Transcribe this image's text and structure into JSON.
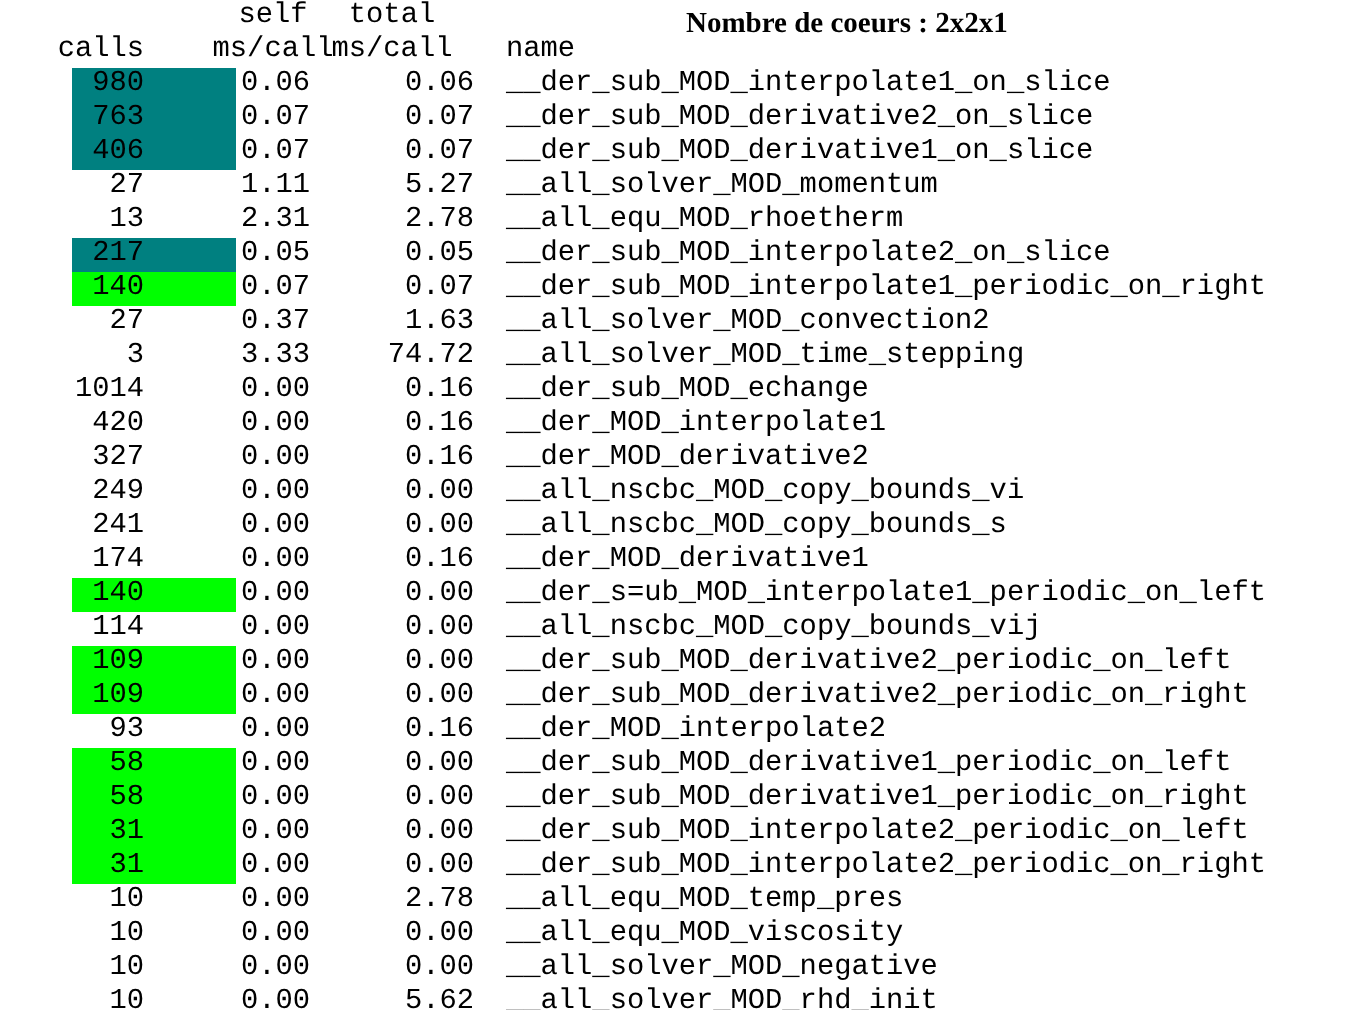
{
  "title": "Nombre de coeurs : 2x2x1",
  "columns": [
    {
      "lines": [
        "calls"
      ]
    },
    {
      "lines": [
        "self",
        "ms/call"
      ]
    },
    {
      "lines": [
        "total",
        "ms/call"
      ]
    },
    {
      "lines": [
        "name"
      ]
    }
  ],
  "rows": [
    {
      "calls": "980",
      "self": "0.06",
      "total": "0.06",
      "name": "__der_sub_MOD_interpolate1_on_slice",
      "color": "#008080"
    },
    {
      "calls": "763",
      "self": "0.07",
      "total": "0.07",
      "name": "__der_sub_MOD_derivative2_on_slice",
      "color": "#008080"
    },
    {
      "calls": "406",
      "self": "0.07",
      "total": "0.07",
      "name": "__der_sub_MOD_derivative1_on_slice",
      "color": "#008080"
    },
    {
      "calls": "27",
      "self": "1.11",
      "total": "5.27",
      "name": "__all_solver_MOD_momentum"
    },
    {
      "calls": "13",
      "self": "2.31",
      "total": "2.78",
      "name": "__all_equ_MOD_rhoetherm"
    },
    {
      "calls": "217",
      "self": "0.05",
      "total": "0.05",
      "name": "__der_sub_MOD_interpolate2_on_slice",
      "color": "#008080"
    },
    {
      "calls": "140",
      "self": "0.07",
      "total": "0.07",
      "name": "__der_sub_MOD_interpolate1_periodic_on_right",
      "color": "#00ff00"
    },
    {
      "calls": "27",
      "self": "0.37",
      "total": "1.63",
      "name": "__all_solver_MOD_convection2"
    },
    {
      "calls": "3",
      "self": "3.33",
      "total": "74.72",
      "name": "__all_solver_MOD_time_stepping"
    },
    {
      "calls": "1014",
      "self": "0.00",
      "total": "0.16",
      "name": "__der_sub_MOD_echange"
    },
    {
      "calls": "420",
      "self": "0.00",
      "total": "0.16",
      "name": "__der_MOD_interpolate1"
    },
    {
      "calls": "327",
      "self": "0.00",
      "total": "0.16",
      "name": "__der_MOD_derivative2"
    },
    {
      "calls": "249",
      "self": "0.00",
      "total": "0.00",
      "name": "__all_nscbc_MOD_copy_bounds_vi"
    },
    {
      "calls": "241",
      "self": "0.00",
      "total": "0.00",
      "name": "__all_nscbc_MOD_copy_bounds_s"
    },
    {
      "calls": "174",
      "self": "0.00",
      "total": "0.16",
      "name": "__der_MOD_derivative1"
    },
    {
      "calls": "140",
      "self": "0.00",
      "total": "0.00",
      "name": "__der_s=ub_MOD_interpolate1_periodic_on_left",
      "color": "#00ff00"
    },
    {
      "calls": "114",
      "self": "0.00",
      "total": "0.00",
      "name": "__all_nscbc_MOD_copy_bounds_vij"
    },
    {
      "calls": "109",
      "self": "0.00",
      "total": "0.00",
      "name": "__der_sub_MOD_derivative2_periodic_on_left",
      "color": "#00ff00"
    },
    {
      "calls": "109",
      "self": "0.00",
      "total": "0.00",
      "name": "__der_sub_MOD_derivative2_periodic_on_right",
      "color": "#00ff00"
    },
    {
      "calls": "93",
      "self": "0.00",
      "total": "0.16",
      "name": "__der_MOD_interpolate2"
    },
    {
      "calls": "58",
      "self": "0.00",
      "total": "0.00",
      "name": "__der_sub_MOD_derivative1_periodic_on_left",
      "color": "#00ff00"
    },
    {
      "calls": "58",
      "self": "0.00",
      "total": "0.00",
      "name": "__der_sub_MOD_derivative1_periodic_on_right",
      "color": "#00ff00"
    },
    {
      "calls": "31",
      "self": "0.00",
      "total": "0.00",
      "name": "__der_sub_MOD_interpolate2_periodic_on_left",
      "color": "#00ff00"
    },
    {
      "calls": "31",
      "self": "0.00",
      "total": "0.00",
      "name": "__der_sub_MOD_interpolate2_periodic_on_right",
      "color": "#00ff00"
    },
    {
      "calls": "10",
      "self": "0.00",
      "total": "2.78",
      "name": "__all_equ_MOD_temp_pres"
    },
    {
      "calls": "10",
      "self": "0.00",
      "total": "0.00",
      "name": "__all_equ_MOD_viscosity"
    },
    {
      "calls": "10",
      "self": "0.00",
      "total": "0.00",
      "name": "__all_solver_MOD_negative"
    },
    {
      "calls": "10",
      "self": "0.00",
      "total": "5.62",
      "name": "__all_solver_MOD_rhd_init"
    }
  ]
}
